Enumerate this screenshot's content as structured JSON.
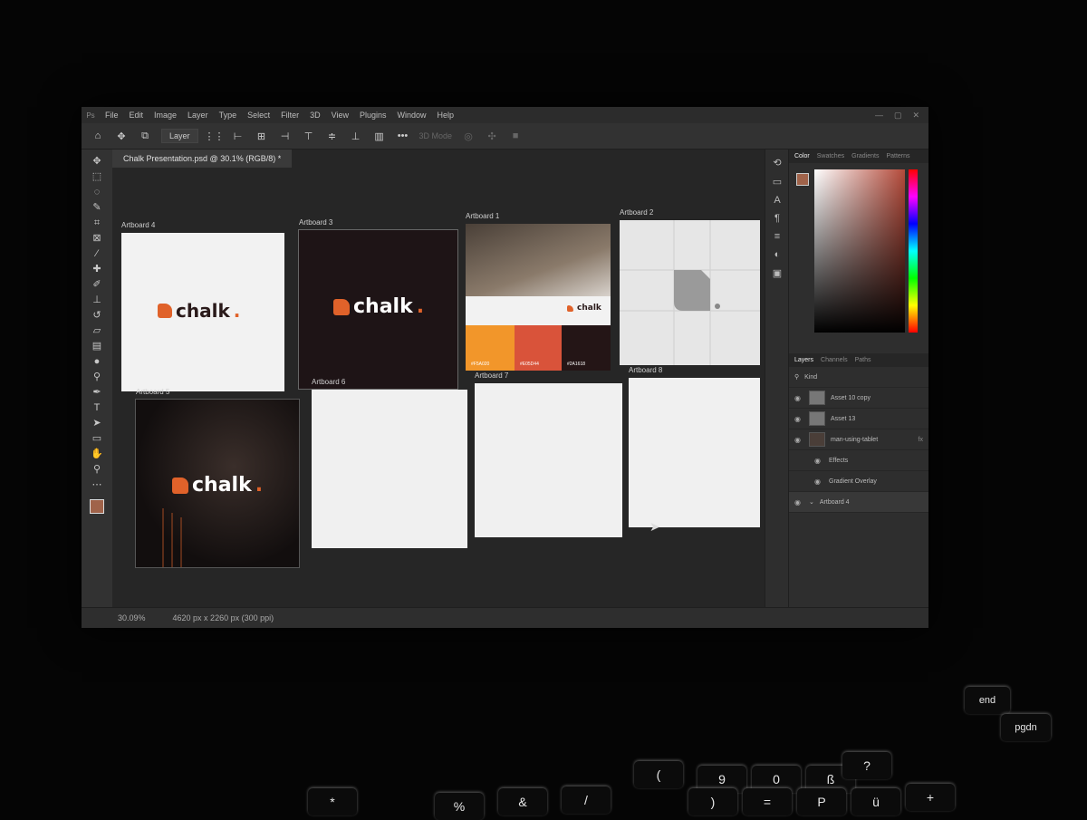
{
  "menubar": {
    "items": [
      "File",
      "Edit",
      "Image",
      "Layer",
      "Type",
      "Select",
      "Filter",
      "3D",
      "View",
      "Plugins",
      "Window",
      "Help"
    ]
  },
  "options_bar": {
    "layer_select": "Layer",
    "mode_3d": "3D Mode"
  },
  "document": {
    "tab_title": "Chalk Presentation.psd @ 30.1% (RGB/8) *"
  },
  "artboards": [
    {
      "label": "Artboard 4",
      "bg": "#f2f2f2",
      "logo_text": "chalk",
      "logo_color": "#2a1a1a"
    },
    {
      "label": "Artboard 3",
      "bg": "#1e1416",
      "logo_text": "chalk",
      "logo_color": "#ffffff"
    },
    {
      "label": "Artboard 1",
      "bg": "#f2f2f2",
      "logo_text": "chalk",
      "logo_color": "#2a1a1a",
      "swatches": [
        "#f2962a",
        "#d9533a",
        "#241516"
      ],
      "swatch_labels": [
        "#F5A020",
        "#E05D44",
        "#2A1618"
      ]
    },
    {
      "label": "Artboard 2",
      "bg": "#e6e6e6"
    },
    {
      "label": "Artboard 5",
      "bg": "#1a1414",
      "logo_text": "chalk",
      "logo_color": "#ffffff"
    },
    {
      "label": "Artboard 6",
      "bg": "#f0f0f0"
    },
    {
      "label": "Artboard 7",
      "bg": "#f0f0f0"
    },
    {
      "label": "Artboard 8",
      "bg": "#f0f0f0"
    }
  ],
  "color_panel": {
    "tabs": [
      "Color",
      "Swatches",
      "Gradients",
      "Patterns"
    ],
    "foreground": "#a0634a"
  },
  "layers_panel": {
    "tabs": [
      "Layers",
      "Channels",
      "Paths"
    ],
    "filter": "Kind",
    "rows": [
      "Asset 10 copy",
      "Asset 13",
      "man-using-tablet",
      "Effects",
      "Gradient Overlay",
      "Artboard 4"
    ]
  },
  "status": {
    "zoom": "30.09%",
    "doc_info": "4620 px x 2260 px (300 ppi)"
  },
  "keyboard": {
    "keys": [
      "end",
      "pgdn",
      "9",
      "0",
      "ß",
      "P",
      "ü",
      "+",
      "*",
      "%",
      "&",
      "/",
      "(",
      ")",
      "=",
      "?"
    ]
  }
}
